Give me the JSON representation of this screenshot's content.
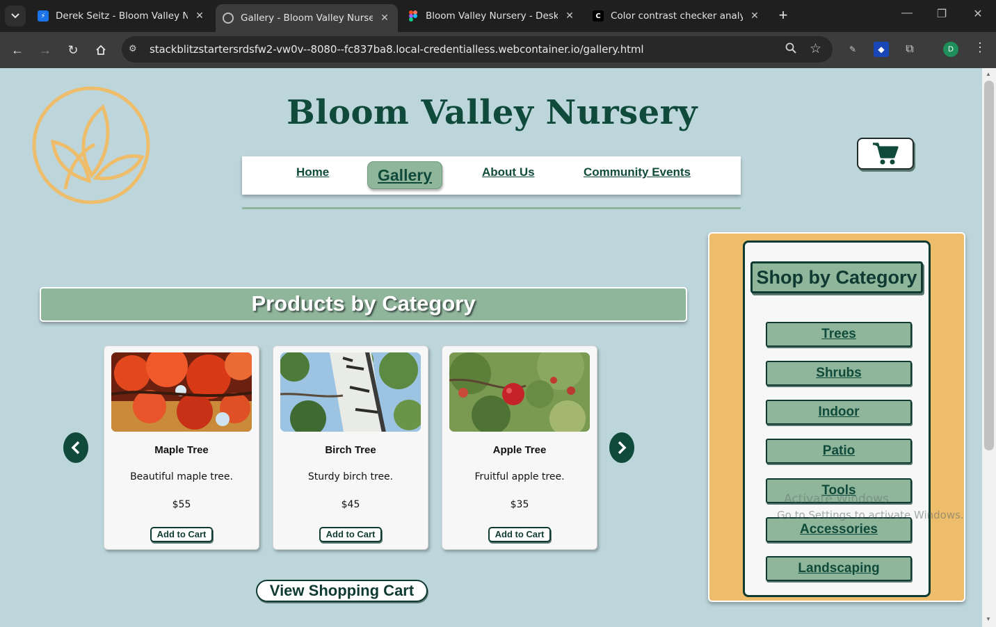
{
  "browser": {
    "tabs": [
      {
        "title": "Derek Seitz - Bloom Valley Nurs",
        "favicon": "bolt-icon",
        "active": false
      },
      {
        "title": "Gallery - Bloom Valley Nursery",
        "favicon": "globe-icon",
        "active": true
      },
      {
        "title": "Bloom Valley Nursery - Desktop",
        "favicon": "figma-icon",
        "active": false
      },
      {
        "title": "Color contrast checker analyzer",
        "favicon": "contrast-icon",
        "active": false
      }
    ],
    "url": "stackblitzstartersrdsfw2-vw0v--8080--fc837ba8.local-credentialless.webcontainer.io/gallery.html",
    "profile_initial": "D"
  },
  "site": {
    "title": "Bloom Valley Nursery",
    "nav": {
      "home": "Home",
      "gallery": "Gallery",
      "about": "About Us",
      "events": "Community Events"
    },
    "products_heading": "Products by Category",
    "products": [
      {
        "name": "Maple Tree",
        "desc": "Beautiful maple tree.",
        "price": "$55",
        "button": "Add to Cart"
      },
      {
        "name": "Birch Tree",
        "desc": "Sturdy birch tree.",
        "price": "$45",
        "button": "Add to Cart"
      },
      {
        "name": "Apple Tree",
        "desc": "Fruitful apple tree.",
        "price": "$35",
        "button": "Add to Cart"
      }
    ],
    "view_cart": "View Shopping Cart",
    "sidebar": {
      "title": "Shop by Category",
      "categories": [
        "Trees",
        "Shrubs",
        "Indoor",
        "Patio",
        "Tools",
        "Accessories",
        "Landscaping"
      ]
    }
  },
  "os_overlay": {
    "title": "Activate Windows",
    "line": "Go to Settings to activate Windows."
  },
  "colors": {
    "page_bg": "#bdd6dc",
    "brand_green": "#0f4a3a",
    "sage": "#8fb59b",
    "gold": "#edbd6c"
  }
}
